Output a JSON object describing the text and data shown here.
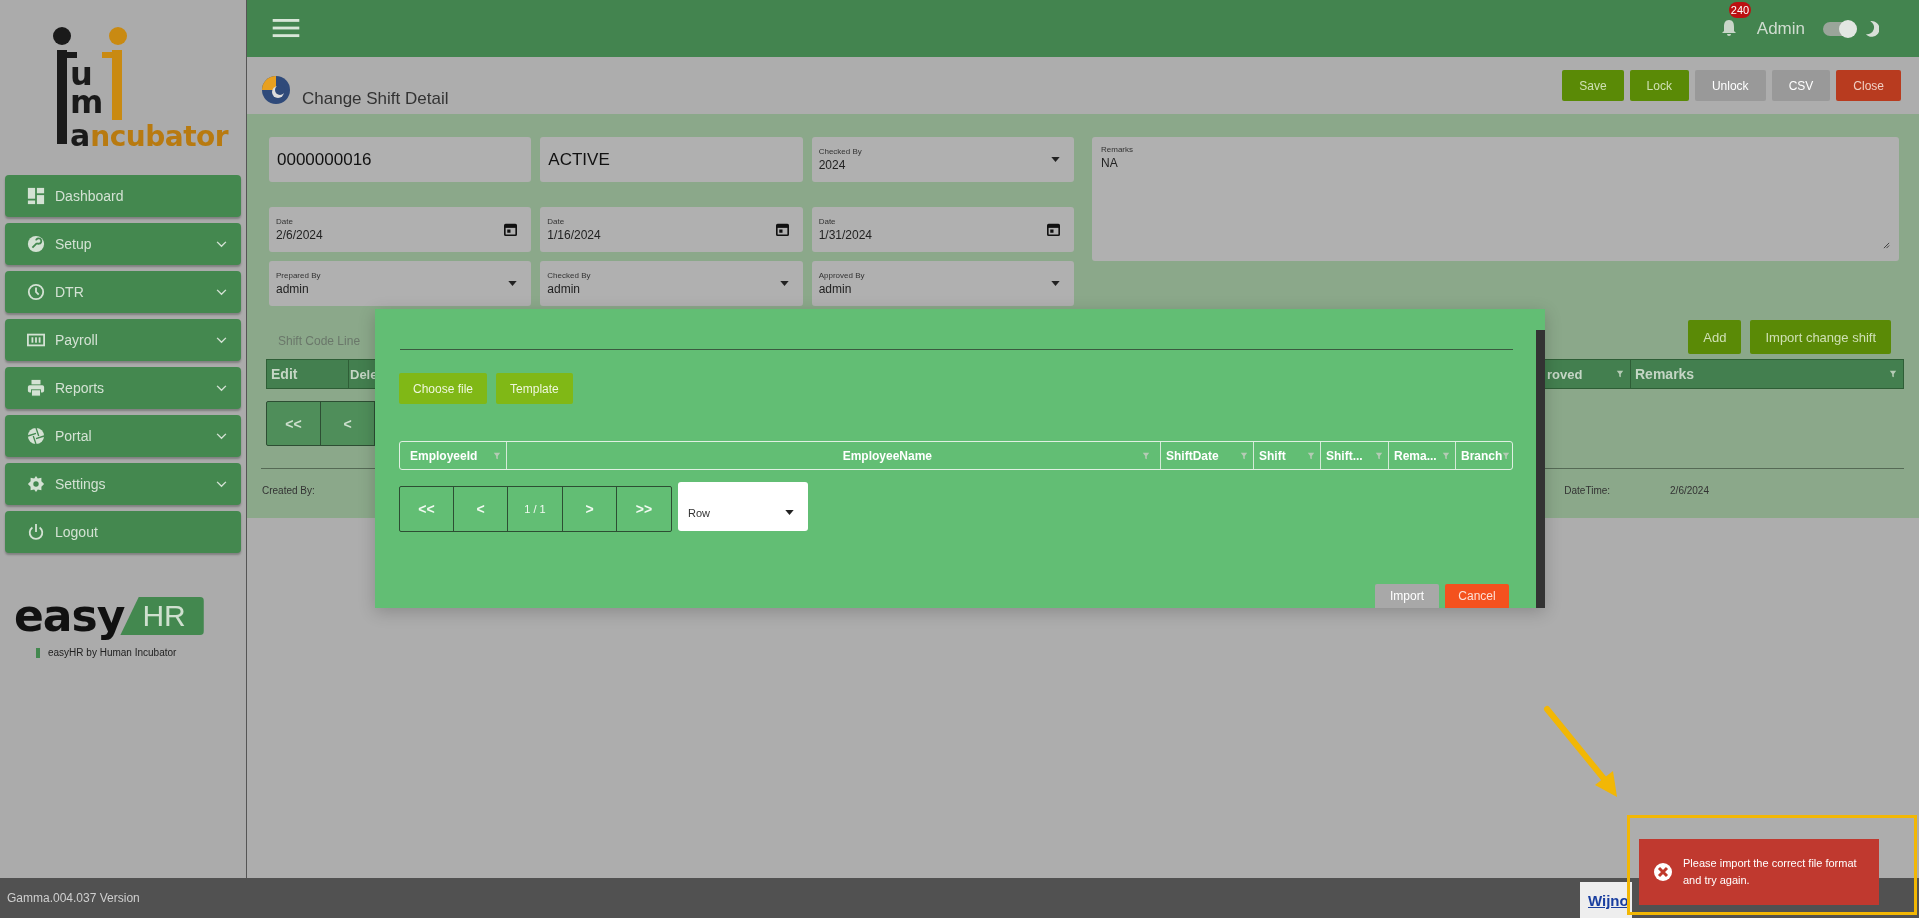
{
  "topbar": {
    "notifications": "240",
    "user": "Admin",
    "theme_toggle_on": true
  },
  "sidebar": {
    "logo": {
      "stack": [
        "u",
        "m"
      ],
      "base": "a",
      "accent": "ncubator"
    },
    "items": [
      {
        "label": "Dashboard",
        "has_submenu": false
      },
      {
        "label": "Setup",
        "has_submenu": true
      },
      {
        "label": "DTR",
        "has_submenu": true
      },
      {
        "label": "Payroll",
        "has_submenu": true
      },
      {
        "label": "Reports",
        "has_submenu": true
      },
      {
        "label": "Portal",
        "has_submenu": true
      },
      {
        "label": "Settings",
        "has_submenu": true
      },
      {
        "label": "Logout",
        "has_submenu": false
      }
    ],
    "brand": {
      "name": "easy",
      "badge": "HR",
      "caption": "easyHR by Human Incubator"
    }
  },
  "page": {
    "title": "Change Shift Detail",
    "buttons": [
      {
        "label": "Save",
        "kind": "primary",
        "disabled": false
      },
      {
        "label": "Lock",
        "kind": "primary",
        "disabled": false
      },
      {
        "label": "Unlock",
        "kind": "primary",
        "disabled": true
      },
      {
        "label": "CSV",
        "kind": "primary",
        "disabled": true
      },
      {
        "label": "Close",
        "kind": "danger",
        "disabled": false
      }
    ]
  },
  "form": {
    "rows": [
      [
        {
          "kind": "text",
          "value": "0000000016"
        },
        {
          "kind": "text",
          "value": "ACTIVE"
        },
        {
          "kind": "select",
          "label": "Checked By",
          "value": "2024"
        }
      ],
      [
        {
          "kind": "date",
          "label": "Date",
          "value": "2/6/2024"
        },
        {
          "kind": "date",
          "label": "Date",
          "value": "1/16/2024"
        },
        {
          "kind": "date",
          "label": "Date",
          "value": "1/31/2024"
        }
      ],
      [
        {
          "kind": "select",
          "label": "Prepared By",
          "value": "admin"
        },
        {
          "kind": "select",
          "label": "Checked By",
          "value": "admin"
        },
        {
          "kind": "select",
          "label": "Approved By",
          "value": "admin"
        }
      ]
    ],
    "remarks": {
      "label": "Remarks",
      "value": "NA"
    }
  },
  "section_label": "Shift Code Line",
  "grid_actions": [
    "Add",
    "Import change shift"
  ],
  "grid": {
    "left_columns": [
      "Edit",
      "Dele"
    ],
    "right_columns": [
      "roved",
      "Remarks"
    ],
    "pager": [
      "<<",
      "<"
    ]
  },
  "footer_info": {
    "created_by": "Created By:",
    "datetime_label": "DateTime:",
    "datetime": "2/6/2024"
  },
  "modal": {
    "buttons": [
      "Choose file",
      "Template"
    ],
    "columns": [
      "EmployeeId",
      "EmployeeName",
      "ShiftDate",
      "Shift",
      "Shift...",
      "Rema...",
      "Branch"
    ],
    "pager": [
      "<<",
      "<",
      "1 / 1",
      ">",
      ">>"
    ],
    "page_size": "Row",
    "actions": [
      {
        "label": "Import",
        "kind": "primary",
        "disabled": true
      },
      {
        "label": "Cancel",
        "kind": "danger",
        "disabled": false
      }
    ]
  },
  "toast": {
    "kind": "error",
    "message": "Please import the correct file format and try again."
  },
  "status_bar": {
    "version": "Gamma.004.037 Version",
    "link": "Wijno"
  }
}
